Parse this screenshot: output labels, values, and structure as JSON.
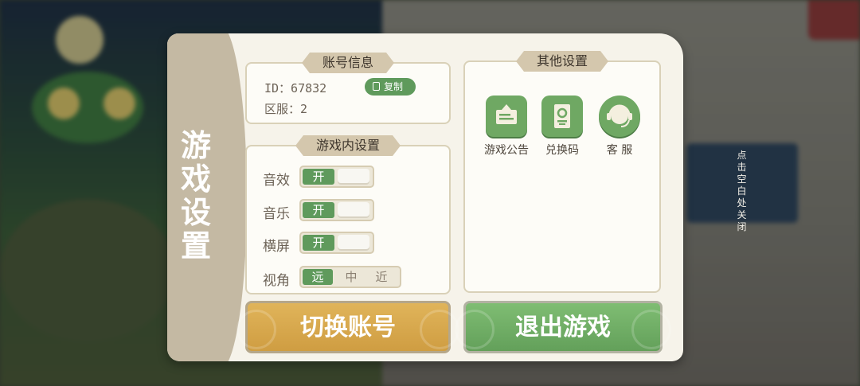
{
  "hint": {
    "close": "点击空白处关闭"
  },
  "dialog": {
    "title": "游戏设置"
  },
  "account": {
    "header": "账号信息",
    "id_label": "ID：67832",
    "server_label": "区服：2",
    "copy_label": "复制"
  },
  "ingame": {
    "header": "游戏内设置",
    "rows": [
      {
        "label": "音效",
        "state": "开"
      },
      {
        "label": "音乐",
        "state": "开"
      },
      {
        "label": "横屏",
        "state": "开"
      }
    ],
    "view": {
      "label": "视角",
      "options": [
        "远",
        "中",
        "近"
      ],
      "selected": "远"
    }
  },
  "other": {
    "header": "其他设置",
    "items": [
      {
        "label": "游戏公告",
        "icon": "announcement-icon"
      },
      {
        "label": "兑换码",
        "icon": "redeem-code-icon"
      },
      {
        "label": "客 服",
        "icon": "customer-service-icon"
      }
    ]
  },
  "actions": {
    "switch_account": "切换账号",
    "exit_game": "退出游戏"
  },
  "colors": {
    "accent_green": "#5f9a5c",
    "orange": "#d8a84e",
    "panel": "#f6f3ea"
  }
}
